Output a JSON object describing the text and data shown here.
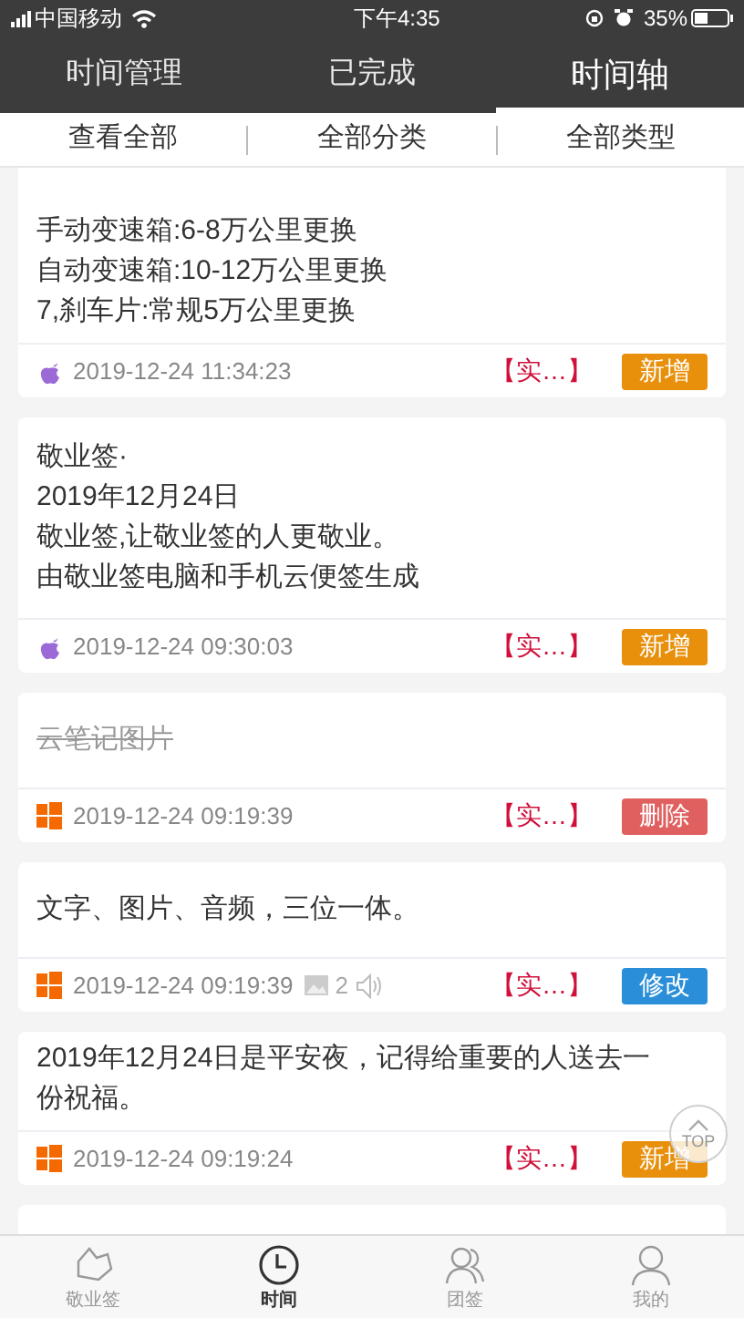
{
  "status_bar": {
    "carrier": "中国移动",
    "time": "下午4:35",
    "battery": "35%"
  },
  "tabs": [
    {
      "label": "时间管理",
      "selected": false
    },
    {
      "label": "已完成",
      "selected": false
    },
    {
      "label": "时间轴",
      "selected": true
    }
  ],
  "filters": [
    "查看全部",
    "全部分类",
    "全部类型"
  ],
  "notes": [
    {
      "lines": [
        "手动变速箱:6-8万公里更换",
        "自动变速箱:10-12万公里更换",
        "7,刹车片:常规5万公里更换"
      ],
      "deleted": false,
      "kind": "apple",
      "date": "2019-12-24 11:34:23",
      "category": "【实…】",
      "action": {
        "kind": "add",
        "label": "新增"
      }
    },
    {
      "lines": [
        "敬业签·",
        "2019年12月24日",
        "敬业签,让敬业签的人更敬业。",
        "由敬业签电脑和手机云便签生成"
      ],
      "deleted": false,
      "kind": "apple",
      "date": "2019-12-24 09:30:03",
      "category": "【实…】",
      "action": {
        "kind": "add",
        "label": "新增"
      }
    },
    {
      "lines": [
        "云笔记图片"
      ],
      "deleted": true,
      "kind": "windows",
      "date": "2019-12-24 09:19:39",
      "category": "【实…】",
      "action": {
        "kind": "delete",
        "label": "删除"
      }
    },
    {
      "lines": [
        "文字、图片、音频，三位一体。"
      ],
      "deleted": false,
      "kind": "windows",
      "date": "2019-12-24 09:19:39",
      "image_count": "2",
      "audio": true,
      "category": "【实…】",
      "action": {
        "kind": "edit",
        "label": "修改"
      }
    },
    {
      "lines": [
        "2019年12月24日是平安夜，记得给重要的人送去一",
        "份祝福。"
      ],
      "deleted": false,
      "kind": "windows",
      "date": "2019-12-24 09:19:24",
      "category": "【实…】",
      "action": {
        "kind": "add",
        "label": "新增"
      }
    }
  ],
  "top_button": "TOP",
  "bottom_nav": [
    {
      "kind": "note",
      "label": "敬业签",
      "selected": false
    },
    {
      "kind": "clock",
      "label": "时间",
      "selected": true
    },
    {
      "kind": "team",
      "label": "团签",
      "selected": false
    },
    {
      "kind": "person",
      "label": "我的",
      "selected": false
    }
  ]
}
